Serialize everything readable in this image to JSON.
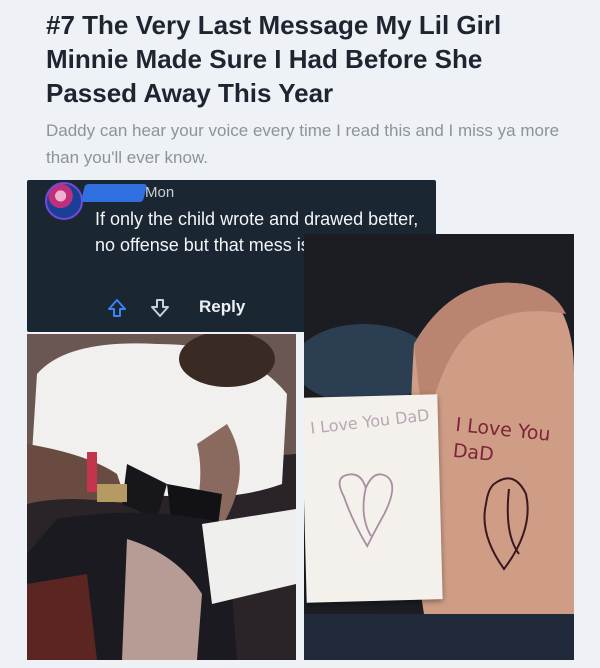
{
  "post": {
    "title": "#7 The Very Last Message My Lil Girl Minnie Made Sure I Had Before She Passed Away This Year",
    "subtitle": "Daddy can hear your voice every time I read this and I miss ya more than you'll ever know."
  },
  "comment": {
    "timestamp": "Mon",
    "text": "If only the child wrote and drawed better, no offense but that mess is a eyesore",
    "reply_label": "Reply",
    "icons": [
      "avatar",
      "upvote-icon",
      "downvote-icon",
      "more-options-icon"
    ]
  },
  "photos": {
    "card_text": "I Love You DaD",
    "tattoo_text": "I Love You DaD"
  },
  "colors": {
    "page_bg": "#eef1f5",
    "comment_bg": "#1b2633",
    "upvote": "#3b82f6",
    "tattoo_ink": "#7d2538"
  }
}
